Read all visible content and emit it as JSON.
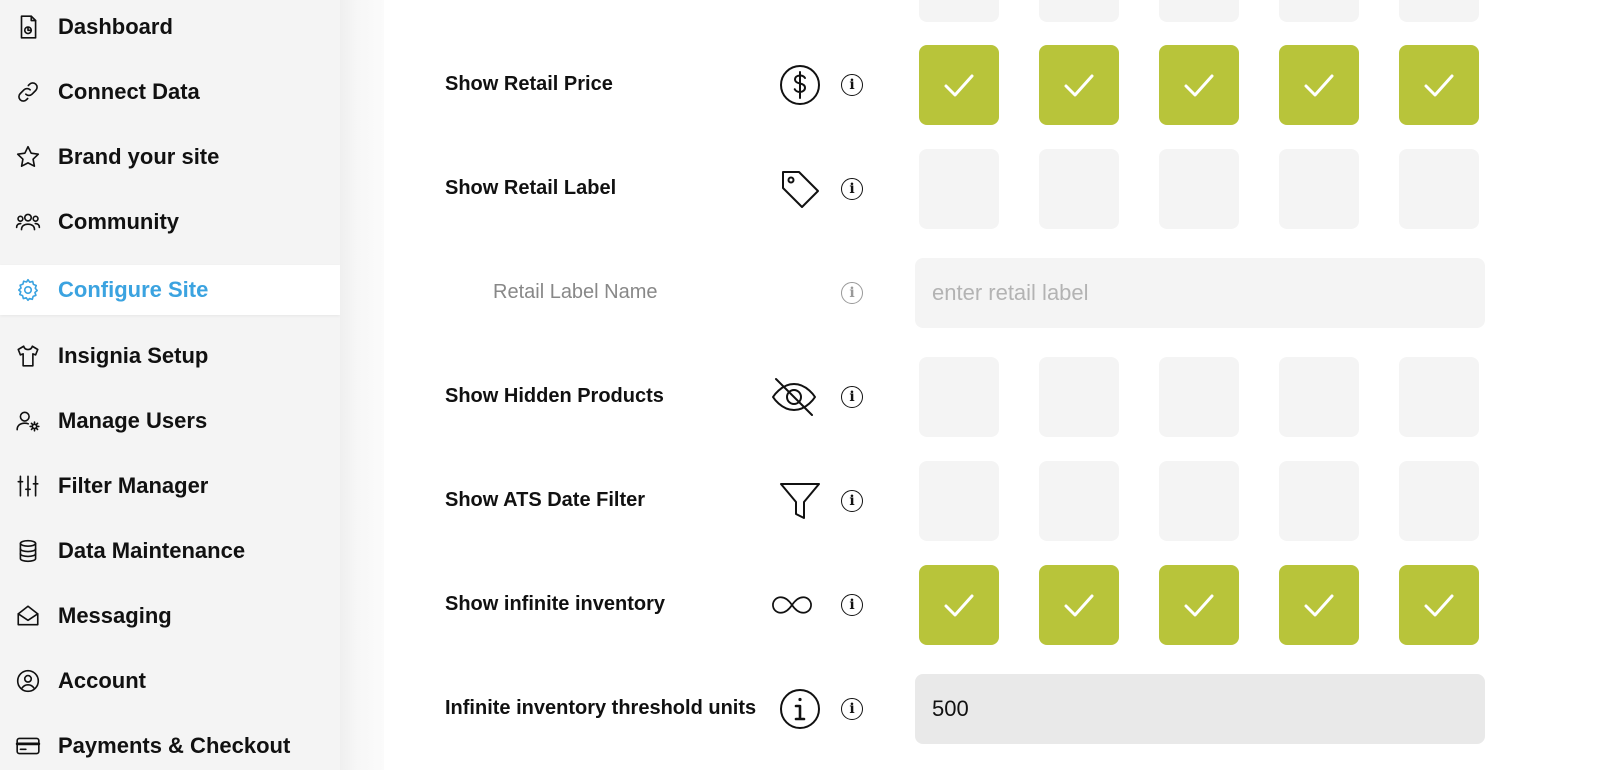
{
  "sidebar": {
    "items": [
      {
        "label": "Dashboard",
        "icon": "dashboard-icon"
      },
      {
        "label": "Connect Data",
        "icon": "link-icon"
      },
      {
        "label": "Brand your site",
        "icon": "star-icon"
      },
      {
        "label": "Community",
        "icon": "users-icon"
      },
      {
        "label": "Configure Site",
        "icon": "gear-icon",
        "active": true
      },
      {
        "label": "Insignia Setup",
        "icon": "shirt-icon"
      },
      {
        "label": "Manage Users",
        "icon": "user-gear-icon"
      },
      {
        "label": "Filter Manager",
        "icon": "sliders-icon"
      },
      {
        "label": "Data Maintenance",
        "icon": "database-icon"
      },
      {
        "label": "Messaging",
        "icon": "mail-open-icon"
      },
      {
        "label": "Account",
        "icon": "user-circle-icon"
      },
      {
        "label": "Payments & Checkout",
        "icon": "credit-card-icon"
      }
    ],
    "active_color": "#3ba3e0"
  },
  "settings": {
    "check_on_color": "#b8c43a",
    "rows": {
      "retail_price": {
        "label": "Show Retail Price",
        "icon": "dollar-circle-icon",
        "checks": [
          true,
          true,
          true,
          true,
          true
        ]
      },
      "retail_label": {
        "label": "Show Retail Label",
        "icon": "tag-icon",
        "checks": [
          false,
          false,
          false,
          false,
          false
        ]
      },
      "retail_label_name": {
        "label": "Retail Label Name",
        "placeholder": "enter retail label",
        "value": ""
      },
      "hidden_products": {
        "label": "Show Hidden Products",
        "icon": "eye-off-icon",
        "checks": [
          false,
          false,
          false,
          false,
          false
        ]
      },
      "ats_date_filter": {
        "label": "Show ATS Date Filter",
        "icon": "funnel-icon",
        "checks": [
          false,
          false,
          false,
          false,
          false
        ]
      },
      "infinite_inventory": {
        "label": "Show infinite inventory",
        "icon": "infinity-icon",
        "checks": [
          true,
          true,
          true,
          true,
          true
        ]
      },
      "threshold_units": {
        "label": "Infinite inventory threshold units",
        "icon": "info-circle-icon",
        "value": "500"
      }
    },
    "info_glyph": "i"
  }
}
